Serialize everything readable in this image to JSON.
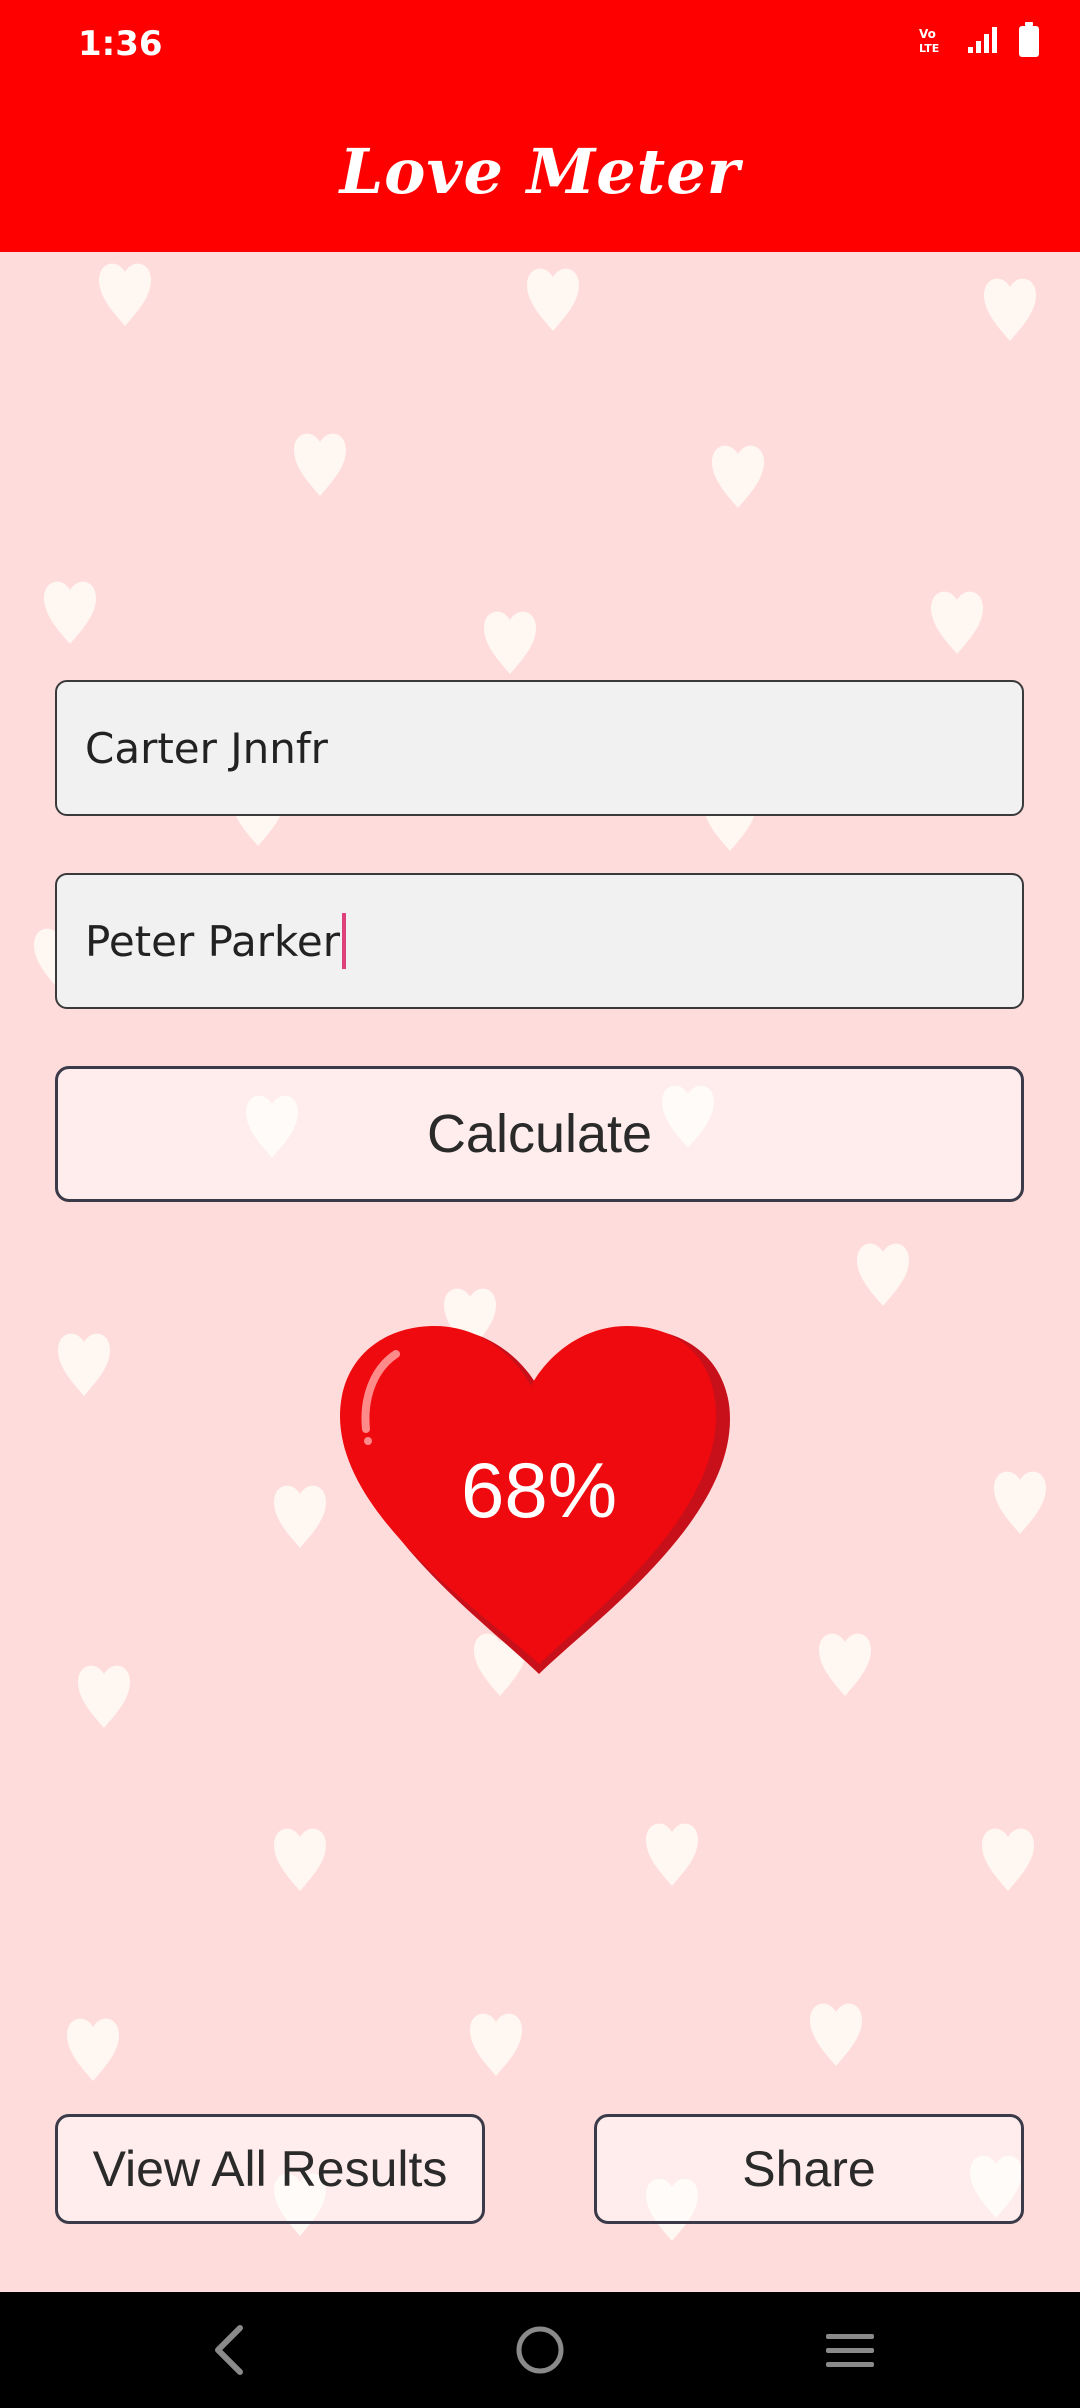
{
  "status_bar": {
    "time": "1:36",
    "icons": [
      "volte-icon",
      "signal-icon",
      "battery-icon"
    ]
  },
  "app_bar": {
    "title": "Love Meter"
  },
  "form": {
    "name1_value": "Carter Jnnfr",
    "name2_value": "Peter Parker",
    "calculate_label": "Calculate"
  },
  "result": {
    "percent_text": "68%",
    "percent_value": 68
  },
  "actions": {
    "view_all_label": "View All Results",
    "share_label": "Share"
  },
  "nav": {
    "icons": [
      "back-icon",
      "home-icon",
      "recents-icon"
    ]
  },
  "colors": {
    "accent": "#ff0000",
    "background": "#ffdcdc",
    "heart": "#ee0a0e",
    "caret": "#e0407a"
  }
}
